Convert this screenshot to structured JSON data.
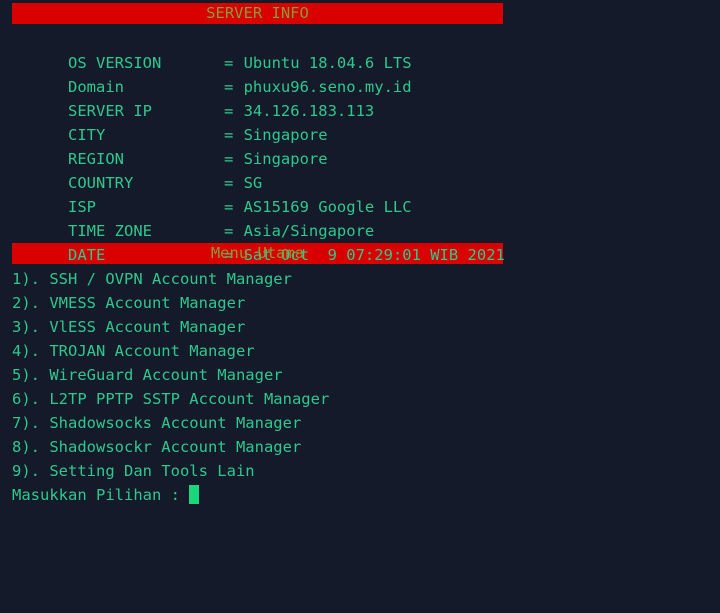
{
  "terminal": {
    "background_color": "#151a2a",
    "text_color": "#2ec88c",
    "banner_bg_color": "#d80000",
    "banner_text_color": "#8a9a38",
    "cursor_color": "#19d67f"
  },
  "server_info": {
    "banner": "SERVER INFO",
    "rows": [
      {
        "label": "OS VERSION",
        "sep": "=",
        "value": "Ubuntu 18.04.6 LTS"
      },
      {
        "label": "Domain",
        "sep": "=",
        "value": "phuxu96.seno.my.id"
      },
      {
        "label": "SERVER IP",
        "sep": "=",
        "value": "34.126.183.113"
      },
      {
        "label": "CITY",
        "sep": "=",
        "value": "Singapore"
      },
      {
        "label": "REGION",
        "sep": "=",
        "value": "Singapore"
      },
      {
        "label": "COUNTRY",
        "sep": "=",
        "value": "SG"
      },
      {
        "label": "ISP",
        "sep": "=",
        "value": "AS15169 Google LLC"
      },
      {
        "label": "TIME ZONE",
        "sep": "=",
        "value": "Asia/Singapore"
      },
      {
        "label": "DATE",
        "sep": "=",
        "value": "Sat Oct  9 07:29:01 WIB 2021"
      }
    ]
  },
  "main_menu": {
    "banner": "Menu Utama",
    "items": [
      {
        "text": "1). SSH / OVPN Account Manager"
      },
      {
        "text": "2). VMESS Account Manager"
      },
      {
        "text": "3). VlESS Account Manager"
      },
      {
        "text": "4). TROJAN Account Manager"
      },
      {
        "text": "5). WireGuard Account Manager"
      },
      {
        "text": "6). L2TP PPTP SSTP Account Manager"
      },
      {
        "text": "7). Shadowsocks Account Manager"
      },
      {
        "text": "8). Shadowsockr Account Manager"
      },
      {
        "text": "9). Setting Dan Tools Lain"
      }
    ]
  },
  "prompt": {
    "text": "Masukkan Pilihan : ",
    "input_value": ""
  }
}
